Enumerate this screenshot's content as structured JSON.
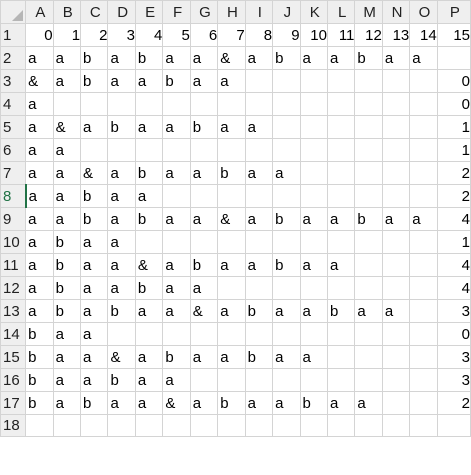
{
  "sheet": {
    "column_headers": [
      "A",
      "B",
      "C",
      "D",
      "E",
      "F",
      "G",
      "H",
      "I",
      "J",
      "K",
      "L",
      "M",
      "N",
      "O",
      "P"
    ],
    "row_headers": [
      "1",
      "2",
      "3",
      "4",
      "5",
      "6",
      "7",
      "8",
      "9",
      "10",
      "11",
      "12",
      "13",
      "14",
      "15",
      "16",
      "17",
      "18"
    ],
    "selected_row": "8",
    "rows": [
      [
        "0",
        "1",
        "2",
        "3",
        "4",
        "5",
        "6",
        "7",
        "8",
        "9",
        "10",
        "11",
        "12",
        "13",
        "14",
        "15"
      ],
      [
        "a",
        "a",
        "b",
        "a",
        "b",
        "a",
        "a",
        "&",
        "a",
        "b",
        "a",
        "a",
        "b",
        "a",
        "a",
        ""
      ],
      [
        "&",
        "a",
        "b",
        "a",
        "a",
        "b",
        "a",
        "a",
        "",
        "",
        "",
        "",
        "",
        "",
        "",
        "0"
      ],
      [
        "a",
        "",
        "",
        "",
        "",
        "",
        "",
        "",
        "",
        "",
        "",
        "",
        "",
        "",
        "",
        "0"
      ],
      [
        "a",
        "&",
        "a",
        "b",
        "a",
        "a",
        "b",
        "a",
        "a",
        "",
        "",
        "",
        "",
        "",
        "",
        "1"
      ],
      [
        "a",
        "a",
        "",
        "",
        "",
        "",
        "",
        "",
        "",
        "",
        "",
        "",
        "",
        "",
        "",
        "1"
      ],
      [
        "a",
        "a",
        "&",
        "a",
        "b",
        "a",
        "a",
        "b",
        "a",
        "a",
        "",
        "",
        "",
        "",
        "",
        "2"
      ],
      [
        "a",
        "a",
        "b",
        "a",
        "a",
        "",
        "",
        "",
        "",
        "",
        "",
        "",
        "",
        "",
        "",
        "2"
      ],
      [
        "a",
        "a",
        "b",
        "a",
        "b",
        "a",
        "a",
        "&",
        "a",
        "b",
        "a",
        "a",
        "b",
        "a",
        "a",
        "4"
      ],
      [
        "a",
        "b",
        "a",
        "a",
        "",
        "",
        "",
        "",
        "",
        "",
        "",
        "",
        "",
        "",
        "",
        "1"
      ],
      [
        "a",
        "b",
        "a",
        "a",
        "&",
        "a",
        "b",
        "a",
        "a",
        "b",
        "a",
        "a",
        "",
        "",
        "",
        "4"
      ],
      [
        "a",
        "b",
        "a",
        "a",
        "b",
        "a",
        "a",
        "",
        "",
        "",
        "",
        "",
        "",
        "",
        "",
        "4"
      ],
      [
        "a",
        "b",
        "a",
        "b",
        "a",
        "a",
        "&",
        "a",
        "b",
        "a",
        "a",
        "b",
        "a",
        "a",
        "",
        "3"
      ],
      [
        "b",
        "a",
        "a",
        "",
        "",
        "",
        "",
        "",
        "",
        "",
        "",
        "",
        "",
        "",
        "",
        "0"
      ],
      [
        "b",
        "a",
        "a",
        "&",
        "a",
        "b",
        "a",
        "a",
        "b",
        "a",
        "a",
        "",
        "",
        "",
        "",
        "3"
      ],
      [
        "b",
        "a",
        "a",
        "b",
        "a",
        "a",
        "",
        "",
        "",
        "",
        "",
        "",
        "",
        "",
        "",
        "3"
      ],
      [
        "b",
        "a",
        "b",
        "a",
        "a",
        "&",
        "a",
        "b",
        "a",
        "a",
        "b",
        "a",
        "a",
        "",
        "",
        "2"
      ],
      [
        "",
        "",
        "",
        "",
        "",
        "",
        "",
        "",
        "",
        "",
        "",
        "",
        "",
        "",
        "",
        ""
      ]
    ],
    "bold_cells": [
      "1.0",
      "8.0"
    ]
  }
}
